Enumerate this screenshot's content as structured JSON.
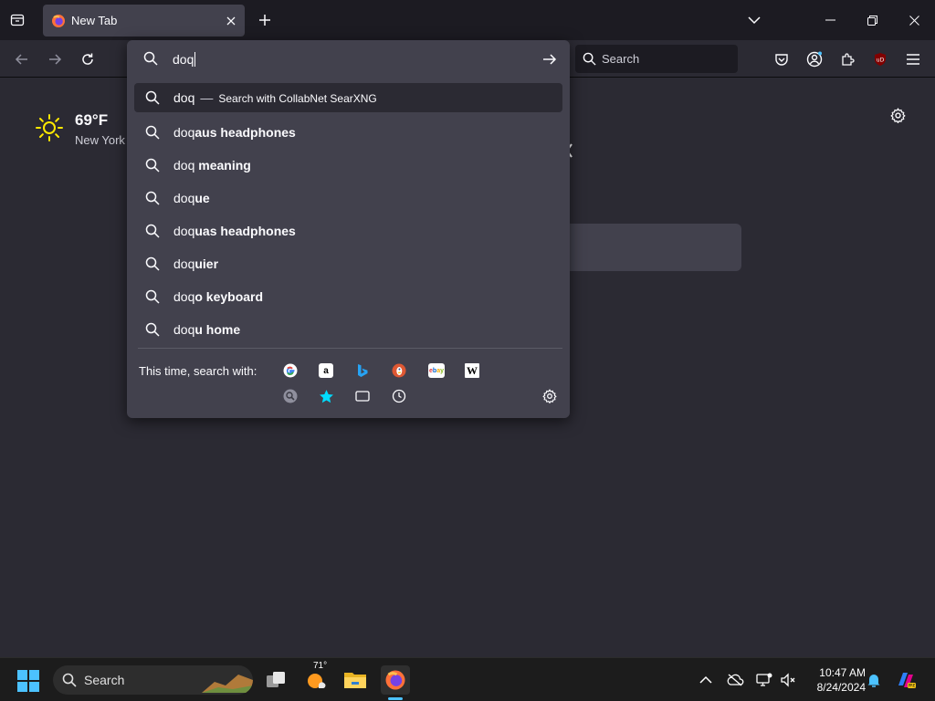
{
  "browser": {
    "tab": {
      "title": "New Tab"
    },
    "toolbar": {
      "search_placeholder": "Search"
    }
  },
  "newtab": {
    "weather": {
      "temperature": "69°F",
      "location": "New York"
    }
  },
  "urlbar": {
    "typed": "doq",
    "results": [
      {
        "typed": "doq",
        "completion": "",
        "action": "Search with CollabNet SearXNG",
        "selected": true
      },
      {
        "typed": "doq",
        "completion": "aus headphones"
      },
      {
        "typed": "doq",
        "completion": " meaning"
      },
      {
        "typed": "doq",
        "completion": "ue"
      },
      {
        "typed": "doq",
        "completion": "uas headphones"
      },
      {
        "typed": "doq",
        "completion": "uier"
      },
      {
        "typed": "doq",
        "completion": "o keyboard"
      },
      {
        "typed": "doq",
        "completion": "u home"
      }
    ],
    "oneoff_label": "This time, search with:",
    "oneoff_engines": [
      "google",
      "amazon",
      "bing",
      "duckduckgo",
      "ebay",
      "wikipedia"
    ],
    "search_modes": [
      "searxng",
      "bookmarks",
      "tabs",
      "history"
    ]
  },
  "taskbar": {
    "search_label": "Search",
    "weather_badge": "71°",
    "time": "10:47 AM",
    "date": "8/24/2024"
  },
  "colors": {
    "accent": "#4cc2ff",
    "panel": "#42414d",
    "chrome": "#1c1b22"
  }
}
